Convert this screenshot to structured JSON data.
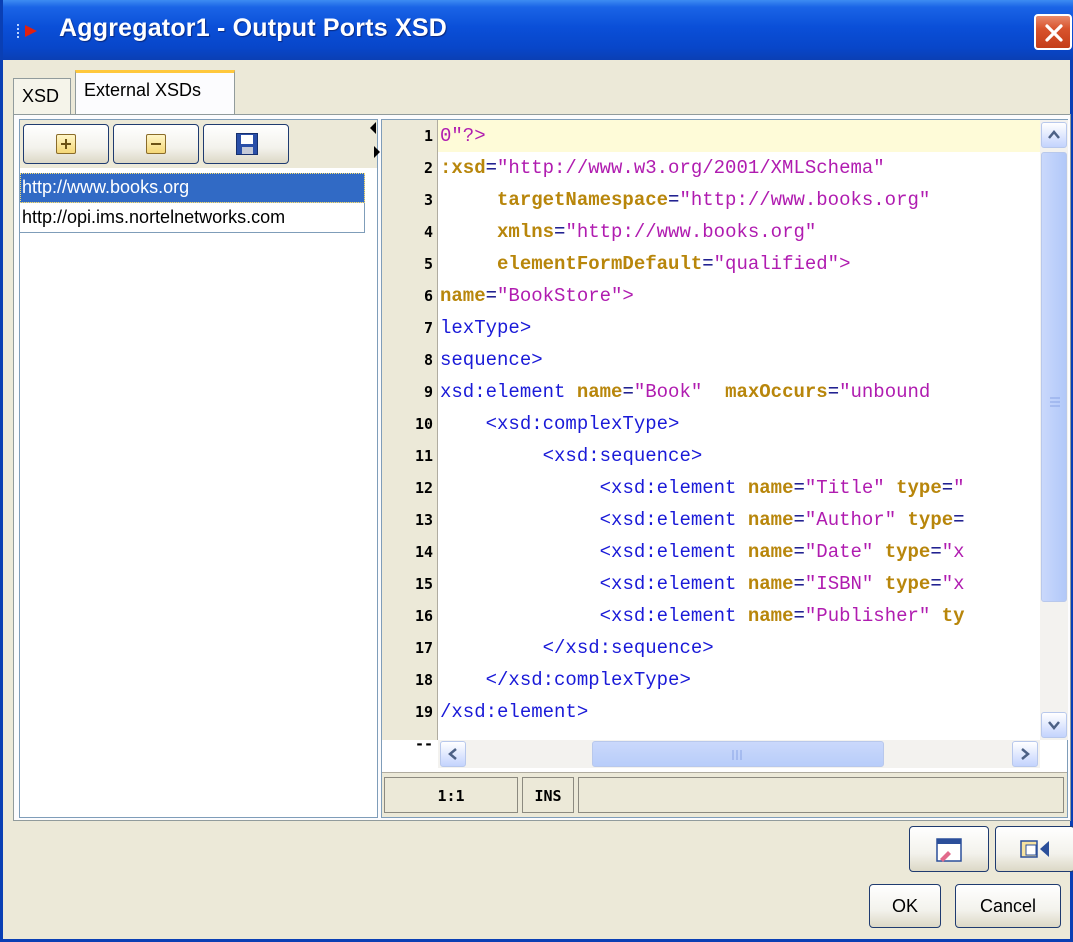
{
  "window": {
    "title": "Aggregator1 - Output Ports XSD"
  },
  "tabs": [
    {
      "label": "XSD"
    },
    {
      "label": "External XSDs"
    }
  ],
  "url_list": [
    "http://www.books.org",
    "http://opi.ims.nortelnetworks.com"
  ],
  "editor": {
    "line_numbers": [
      "1",
      "2",
      "3",
      "4",
      "5",
      "6",
      "7",
      "8",
      "9",
      "10",
      "11",
      "12",
      "13",
      "14",
      "15",
      "16",
      "17",
      "18",
      "19",
      "--"
    ],
    "lines": [
      [
        [
          "str",
          "0\"?>"
        ]
      ],
      [
        [
          "attr",
          ":xsd"
        ],
        [
          "plain",
          "="
        ],
        [
          "str",
          "\"http://www.w3.org/2001/XMLSchema\""
        ]
      ],
      [
        [
          "plain",
          "     "
        ],
        [
          "attr",
          "targetNamespace"
        ],
        [
          "plain",
          "="
        ],
        [
          "str",
          "\"http://www.books.org\""
        ]
      ],
      [
        [
          "plain",
          "     "
        ],
        [
          "attr",
          "xmlns"
        ],
        [
          "plain",
          "="
        ],
        [
          "str",
          "\"http://www.books.org\""
        ]
      ],
      [
        [
          "plain",
          "     "
        ],
        [
          "attr",
          "elementFormDefault"
        ],
        [
          "plain",
          "="
        ],
        [
          "str",
          "\"qualified\">"
        ]
      ],
      [
        [
          "attr",
          "name"
        ],
        [
          "plain",
          "="
        ],
        [
          "str",
          "\"BookStore\">"
        ]
      ],
      [
        [
          "tag",
          "lexType>"
        ]
      ],
      [
        [
          "tag",
          "sequence>"
        ]
      ],
      [
        [
          "tag",
          "xsd:element "
        ],
        [
          "attr",
          "name"
        ],
        [
          "plain",
          "="
        ],
        [
          "str",
          "\"Book\"  "
        ],
        [
          "attr",
          "maxOccurs"
        ],
        [
          "plain",
          "="
        ],
        [
          "str",
          "\"unbound"
        ]
      ],
      [
        [
          "plain",
          "    "
        ],
        [
          "tag",
          "<xsd:complexType>"
        ]
      ],
      [
        [
          "plain",
          "         "
        ],
        [
          "tag",
          "<xsd:sequence>"
        ]
      ],
      [
        [
          "plain",
          "              "
        ],
        [
          "tag",
          "<xsd:element "
        ],
        [
          "attr",
          "name"
        ],
        [
          "plain",
          "="
        ],
        [
          "str",
          "\"Title\" "
        ],
        [
          "attr",
          "type"
        ],
        [
          "plain",
          "="
        ],
        [
          "str",
          "\""
        ]
      ],
      [
        [
          "plain",
          "              "
        ],
        [
          "tag",
          "<xsd:element "
        ],
        [
          "attr",
          "name"
        ],
        [
          "plain",
          "="
        ],
        [
          "str",
          "\"Author\" "
        ],
        [
          "attr",
          "type"
        ],
        [
          "plain",
          "="
        ]
      ],
      [
        [
          "plain",
          "              "
        ],
        [
          "tag",
          "<xsd:element "
        ],
        [
          "attr",
          "name"
        ],
        [
          "plain",
          "="
        ],
        [
          "str",
          "\"Date\" "
        ],
        [
          "attr",
          "type"
        ],
        [
          "plain",
          "="
        ],
        [
          "str",
          "\"x"
        ]
      ],
      [
        [
          "plain",
          "              "
        ],
        [
          "tag",
          "<xsd:element "
        ],
        [
          "attr",
          "name"
        ],
        [
          "plain",
          "="
        ],
        [
          "str",
          "\"ISBN\" "
        ],
        [
          "attr",
          "type"
        ],
        [
          "plain",
          "="
        ],
        [
          "str",
          "\"x"
        ]
      ],
      [
        [
          "plain",
          "              "
        ],
        [
          "tag",
          "<xsd:element "
        ],
        [
          "attr",
          "name"
        ],
        [
          "plain",
          "="
        ],
        [
          "str",
          "\"Publisher\" "
        ],
        [
          "attr",
          "ty"
        ]
      ],
      [
        [
          "plain",
          "         "
        ],
        [
          "tag",
          "</xsd:sequence>"
        ]
      ],
      [
        [
          "plain",
          "    "
        ],
        [
          "tag",
          "</xsd:complexType>"
        ]
      ],
      [
        [
          "tag",
          "/xsd:element>"
        ]
      ],
      [
        [
          "plain",
          ""
        ]
      ]
    ],
    "status": {
      "position": "1:1",
      "mode": "INS"
    }
  },
  "buttons": {
    "ok": "OK",
    "cancel": "Cancel"
  },
  "colors": {
    "title_bar": "#0a4fd8",
    "selection": "#316ac5",
    "xml_tag": "#1a1ad8",
    "xml_attr": "#b8860b",
    "xml_string": "#b01cb0"
  },
  "icons": [
    "app-icon",
    "close-icon",
    "add-icon",
    "remove-icon",
    "save-icon",
    "edit-icon",
    "switch-view-icon"
  ]
}
